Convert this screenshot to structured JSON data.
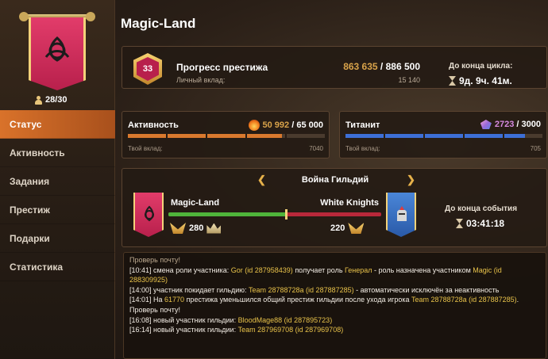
{
  "guild": {
    "name": "Magic-Land",
    "members": "28/30",
    "icon": "celtic-knot-icon"
  },
  "sidebar": {
    "items": [
      {
        "label": "Статус",
        "active": true
      },
      {
        "label": "Активность",
        "active": false
      },
      {
        "label": "Задания",
        "active": false
      },
      {
        "label": "Престиж",
        "active": false
      },
      {
        "label": "Подарки",
        "active": false
      },
      {
        "label": "Статистика",
        "active": false
      }
    ]
  },
  "prestige": {
    "level": "33",
    "label": "Прогресс престижа",
    "current": "863 635",
    "separator": " / ",
    "target": "886 500",
    "contrib_label": "Личный вклад:",
    "contrib_value": "15 140",
    "cycle_label": "До конца цикла:",
    "cycle_value": "9д. 9ч. 41м."
  },
  "activity": {
    "label": "Активность",
    "current": "50 992",
    "separator": " / ",
    "target": "65 000",
    "contrib_label": "Твой вклад:",
    "contrib_value": "7040",
    "progress": 0.7845,
    "color": "#d9792e",
    "icon": "fire-icon"
  },
  "titan": {
    "label": "Титанит",
    "current": "2723",
    "separator": " / ",
    "target": "3000",
    "contrib_label": "Твой вклад:",
    "contrib_value": "705",
    "progress": 0.9077,
    "color": "#3d6fd6",
    "icon": "titanite-gem-icon"
  },
  "war": {
    "title": "Война Гильдий",
    "prev_icon": "chevron-left-icon",
    "next_icon": "chevron-right-icon",
    "team_a": "Magic-Land",
    "team_b": "White Knights",
    "score_a": "280",
    "score_b": "220",
    "ratio": 0.56,
    "event_label": "До конца события",
    "event_value": "03:41:18"
  },
  "log": [
    [
      {
        "t": "Проверь почту!"
      }
    ],
    [
      {
        "t": "[10:41] смена роли участника: "
      },
      {
        "t": "Gor (id 287958439)",
        "hl": true
      },
      {
        "t": " получает роль "
      },
      {
        "t": "Генерал",
        "hl": true
      },
      {
        "t": " - роль назначена участником "
      },
      {
        "t": "Magic (id 288309925)",
        "hl": true
      }
    ],
    [
      {
        "t": "[14:00] участник покидает гильдию: "
      },
      {
        "t": "Team 28788728a (id 287887285)",
        "hl": true
      },
      {
        "t": " - автоматически исключён за неактивность"
      }
    ],
    [
      {
        "t": "[14:01] На "
      },
      {
        "t": "61770",
        "hl": true
      },
      {
        "t": " престижа уменьшился общий престиж гильдии после ухода игрока "
      },
      {
        "t": "Team 28788728a (id 287887285)",
        "hl": true
      },
      {
        "t": ". Проверь почту!"
      }
    ],
    [
      {
        "t": "[16:08] новый участник гильдии: "
      },
      {
        "t": "BloodMage88 (id 287895723)",
        "hl": true
      }
    ],
    [
      {
        "t": "[16:14] новый участник гильдии: "
      },
      {
        "t": "Team 287969708 (id 287969708)",
        "hl": true
      }
    ]
  ]
}
